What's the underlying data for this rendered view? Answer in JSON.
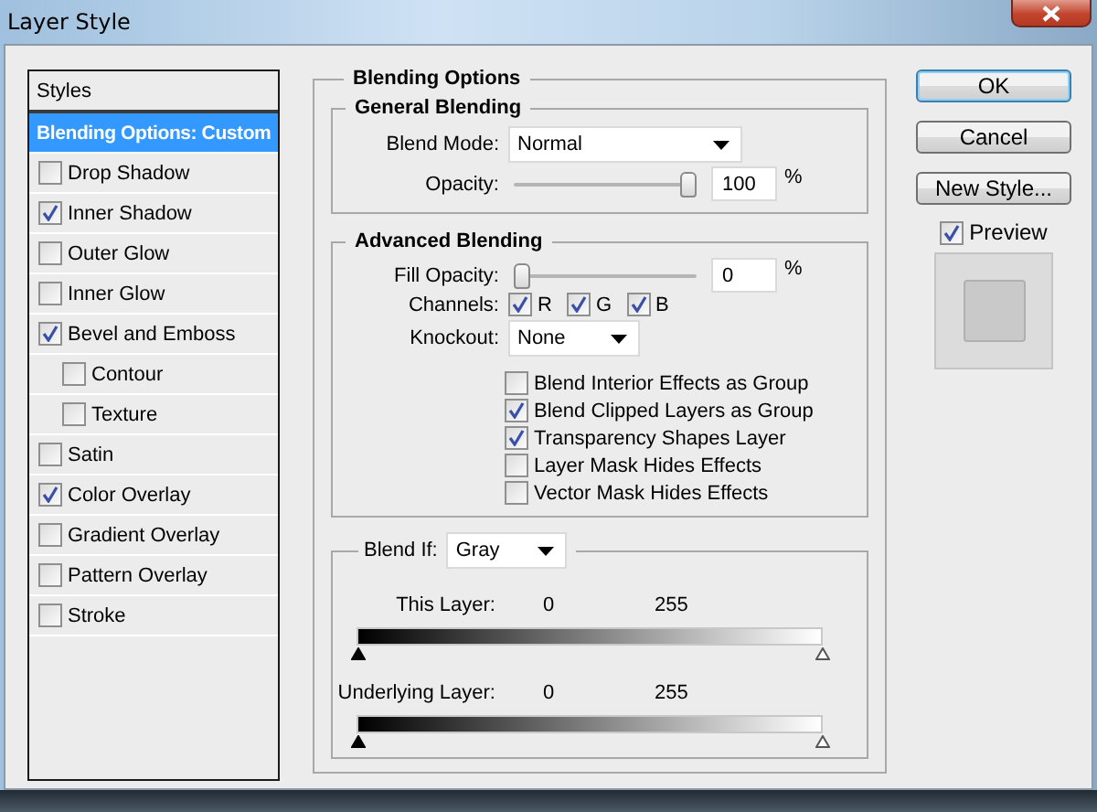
{
  "window": {
    "title": "Layer Style"
  },
  "styles": {
    "header": "Styles",
    "items": [
      {
        "label": "Blending Options: Custom",
        "kind": "heading",
        "selected": true
      },
      {
        "label": "Drop Shadow",
        "kind": "check",
        "checked": false,
        "selected": false
      },
      {
        "label": "Inner Shadow",
        "kind": "check",
        "checked": true,
        "selected": false
      },
      {
        "label": "Outer Glow",
        "kind": "check",
        "checked": false,
        "selected": false
      },
      {
        "label": "Inner Glow",
        "kind": "check",
        "checked": false,
        "selected": false
      },
      {
        "label": "Bevel and Emboss",
        "kind": "check",
        "checked": true,
        "selected": false,
        "children": [
          {
            "label": "Contour",
            "kind": "check",
            "checked": false,
            "selected": false
          },
          {
            "label": "Texture",
            "kind": "check",
            "checked": false,
            "selected": false
          }
        ]
      },
      {
        "label": "Satin",
        "kind": "check",
        "checked": false,
        "selected": false
      },
      {
        "label": "Color Overlay",
        "kind": "check",
        "checked": true,
        "selected": false
      },
      {
        "label": "Gradient Overlay",
        "kind": "check",
        "checked": false,
        "selected": false
      },
      {
        "label": "Pattern Overlay",
        "kind": "check",
        "checked": false,
        "selected": false
      },
      {
        "label": "Stroke",
        "kind": "check",
        "checked": false,
        "selected": false
      }
    ]
  },
  "blending_options": {
    "title": "Blending Options",
    "general": {
      "title": "General Blending",
      "blend_mode": {
        "label": "Blend Mode:",
        "value": "Normal"
      },
      "opacity": {
        "label": "Opacity:",
        "level": 1,
        "value": "100",
        "unit": "%"
      }
    },
    "advanced": {
      "title": "Advanced Blending",
      "fill_opacity": {
        "label": "Fill Opacity:",
        "level": 0,
        "value": "0",
        "unit": "%"
      },
      "channels": {
        "label": "Channels:",
        "items": [
          {
            "label": "R",
            "checked": true
          },
          {
            "label": "G",
            "checked": true
          },
          {
            "label": "B",
            "checked": true
          }
        ]
      },
      "knockout": {
        "label": "Knockout:",
        "value": "None"
      },
      "options": [
        {
          "label": "Blend Interior Effects as Group",
          "checked": false
        },
        {
          "label": "Blend Clipped Layers as Group",
          "checked": true
        },
        {
          "label": "Transparency Shapes Layer",
          "checked": true
        },
        {
          "label": "Layer Mask Hides Effects",
          "checked": false
        },
        {
          "label": "Vector Mask Hides Effects",
          "checked": false
        }
      ]
    },
    "blend_if": {
      "label": "Blend If:",
      "value": "Gray",
      "ranges": [
        {
          "label": "This Layer:",
          "low": "0",
          "high": "255"
        },
        {
          "label": "Underlying Layer:",
          "low": "0",
          "high": "255"
        }
      ]
    }
  },
  "buttons": [
    {
      "label": "OK",
      "default": true
    },
    {
      "label": "Cancel",
      "default": false
    },
    {
      "label": "New Style...",
      "default": false
    }
  ],
  "preview": {
    "label": "Preview",
    "checked": true
  }
}
